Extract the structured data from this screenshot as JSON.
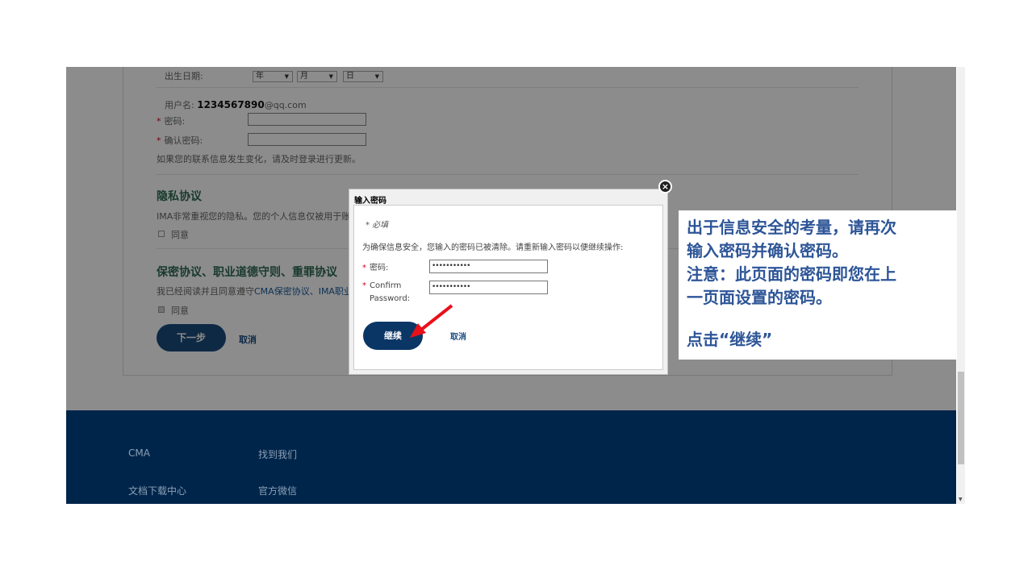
{
  "form": {
    "dob_label": "出生日期:",
    "year_select": "年",
    "month_select": "月",
    "day_select": "日",
    "username_label": "用户名:",
    "username_bold": "1234567890",
    "username_domain": "@qq.com",
    "password_label": "密码:",
    "confirm_label": "确认密码:",
    "contact_note": "如果您的联系信息发生变化，请及时登录进行更新。",
    "privacy_heading": "隐私协议",
    "privacy_text": "IMA非常重视您的隐私。您的个人信息仅被用于账户管",
    "agree_label": "同意",
    "confidential_heading": "保密协议、职业道德守则、重罪协议",
    "confidential_text_prefix": "我已经阅读并且同意遵守",
    "confidential_link": "CMA保密协议、IMA职业道",
    "agree2_label": "同意",
    "next_button": "下一步",
    "cancel_link": "取消"
  },
  "footer": {
    "cma": "CMA",
    "find_us": "找到我们",
    "docs": "文档下载中心",
    "wechat": "官方微信"
  },
  "dialog": {
    "title": "输入密码",
    "required": "* 必填",
    "message": "为确保信息安全，您输入的密码已被清除。请重新输入密码以便继续操作:",
    "password_label": "密码:",
    "password_value": "•••••••••••",
    "confirm_label_line1": "Confirm",
    "confirm_label_line2": "Password:",
    "confirm_value": "•••••••••••",
    "continue_button": "继续",
    "cancel_link": "取消"
  },
  "annotation": {
    "line1": "出于信息安全的考量，请再次",
    "line2": "输入密码并确认密码。",
    "line3": "注意：此页面的密码即您在上",
    "line4": "一页面设置的密码。",
    "line5": "点击“继续”"
  },
  "colors": {
    "footer_bg": "#002b55",
    "button_bg": "#0a3666",
    "annotation_text": "#2d5597",
    "arrow": "#e8101a"
  }
}
